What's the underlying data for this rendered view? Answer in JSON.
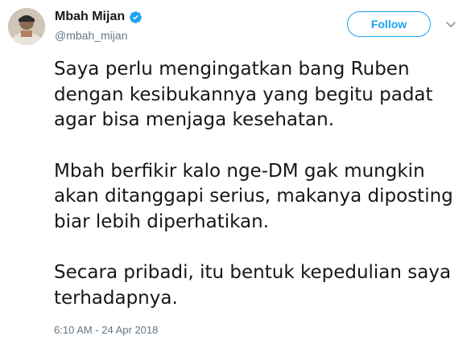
{
  "user": {
    "display_name": "Mbah Mijan",
    "handle": "@mbah_mijan",
    "verified": true
  },
  "actions": {
    "follow_label": "Follow"
  },
  "tweet": {
    "paragraphs": [
      "Saya perlu mengingatkan bang Ruben dengan kesibukannya yang begitu padat agar bisa menjaga kesehatan.",
      "Mbah berfikir kalo nge-DM gak mungkin akan ditanggapi serius, makanya diposting biar lebih diperhatikan.",
      "Secara pribadi, itu bentuk kepedulian saya terhadapnya."
    ],
    "timestamp": "6:10 AM - 24 Apr 2018"
  },
  "icons": {
    "verified": "verified-badge-icon",
    "menu": "chevron-down-icon"
  },
  "colors": {
    "accent": "#1da1f2",
    "text": "#14171a",
    "secondary": "#657786"
  }
}
